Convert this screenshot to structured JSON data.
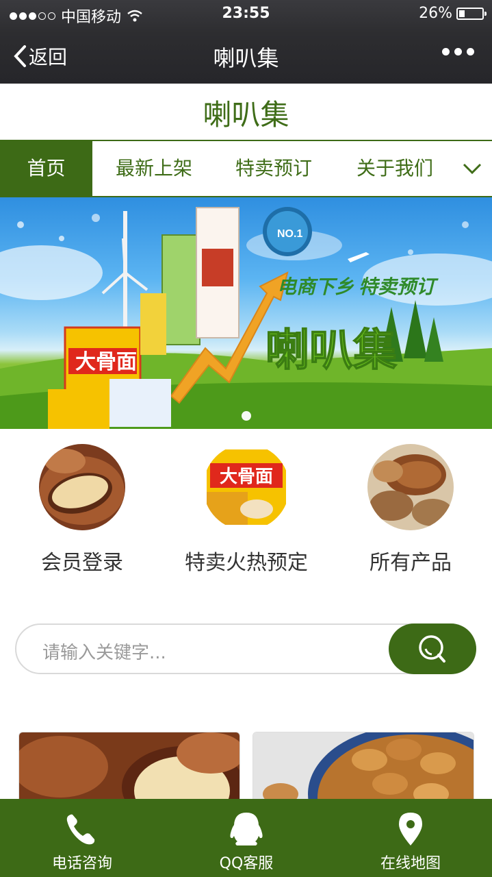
{
  "status_bar": {
    "carrier": "中国移动",
    "time": "23:55",
    "battery": "26%",
    "battery_level": 0.26
  },
  "nav_bar": {
    "back_label": "返回",
    "title": "喇叭集"
  },
  "site": {
    "title": "喇叭集"
  },
  "menu": {
    "items": [
      "首页",
      "最新上架",
      "特卖预订",
      "关于我们"
    ],
    "active_index": 0
  },
  "banner": {
    "slogan": "电商下乡 特卖预订",
    "brand_text": "喇叭集",
    "package_text": "大骨面",
    "badge_text": "NO.1",
    "slide_count": 1,
    "active_slide": 0
  },
  "quick_links": [
    {
      "label": "会员登录",
      "icon": "pine-nut-photo"
    },
    {
      "label": "特卖火热预定",
      "icon": "noodle-package-photo"
    },
    {
      "label": "所有产品",
      "icon": "pecan-photo"
    }
  ],
  "quick_package_text": "大骨面",
  "search": {
    "placeholder": "请输入关键字..."
  },
  "bottom_bar": {
    "tabs": [
      {
        "label": "电话咨询",
        "icon": "phone-icon"
      },
      {
        "label": "QQ客服",
        "icon": "qq-icon"
      },
      {
        "label": "在线地图",
        "icon": "map-pin-icon"
      }
    ]
  },
  "colors": {
    "brand_green": "#3d6a16",
    "title_green": "#3f6d18",
    "nav_dark": "#2d2d30"
  }
}
